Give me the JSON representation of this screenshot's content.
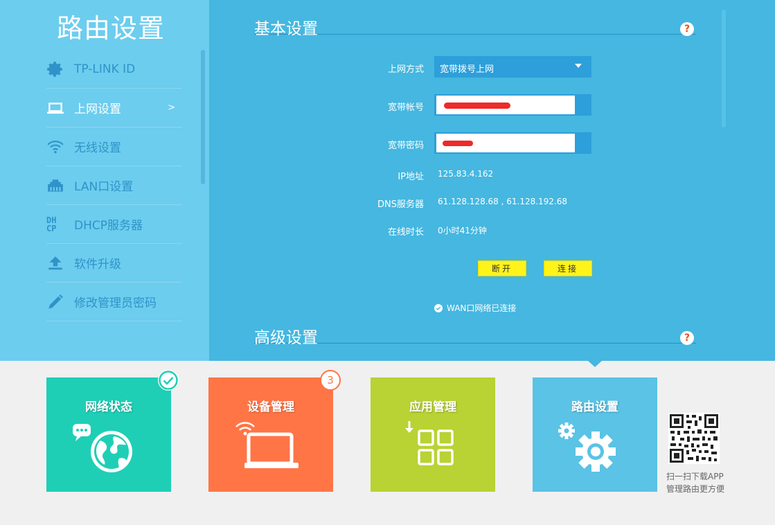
{
  "sidebar": {
    "title": "路由设置",
    "items": [
      {
        "label": "TP-LINK ID",
        "icon": "gear-icon"
      },
      {
        "label": "上网设置",
        "icon": "laptop-icon",
        "arrow": ">"
      },
      {
        "label": "无线设置",
        "icon": "wifi-icon"
      },
      {
        "label": "LAN口设置",
        "icon": "lan-port-icon"
      },
      {
        "label": "DHCP服务器",
        "icon": "dhcp-icon",
        "icon_text": "DH CP"
      },
      {
        "label": "软件升级",
        "icon": "upload-icon"
      },
      {
        "label": "修改管理员密码",
        "icon": "pencil-icon"
      }
    ]
  },
  "basic": {
    "title": "基本设置",
    "help": "?",
    "wan_label": "上网方式",
    "wan_value": "宽带拨号上网",
    "account_label": "宽带帐号",
    "password_label": "宽带密码",
    "ip_label": "IP地址",
    "ip_value": "125.83.4.162",
    "dns_label": "DNS服务器",
    "dns_value": "61.128.128.68 , 61.128.192.68",
    "uptime_label": "在线时长",
    "uptime_value": "0小时41分钟",
    "disconnect": "断开",
    "connect": "连接",
    "status": "WAN口网络已连接"
  },
  "advanced": {
    "title": "高级设置",
    "help": "?"
  },
  "tiles": [
    {
      "label": "网络状态",
      "color": "#1ecfb6",
      "badge": "✓"
    },
    {
      "label": "设备管理",
      "color": "#ff7546",
      "badge": "3"
    },
    {
      "label": "应用管理",
      "color": "#b9d234"
    },
    {
      "label": "路由设置",
      "color": "#5ac3e6"
    }
  ],
  "qr_text": {
    "line1": "扫一扫下载APP",
    "line2": "管理路由更方便"
  }
}
